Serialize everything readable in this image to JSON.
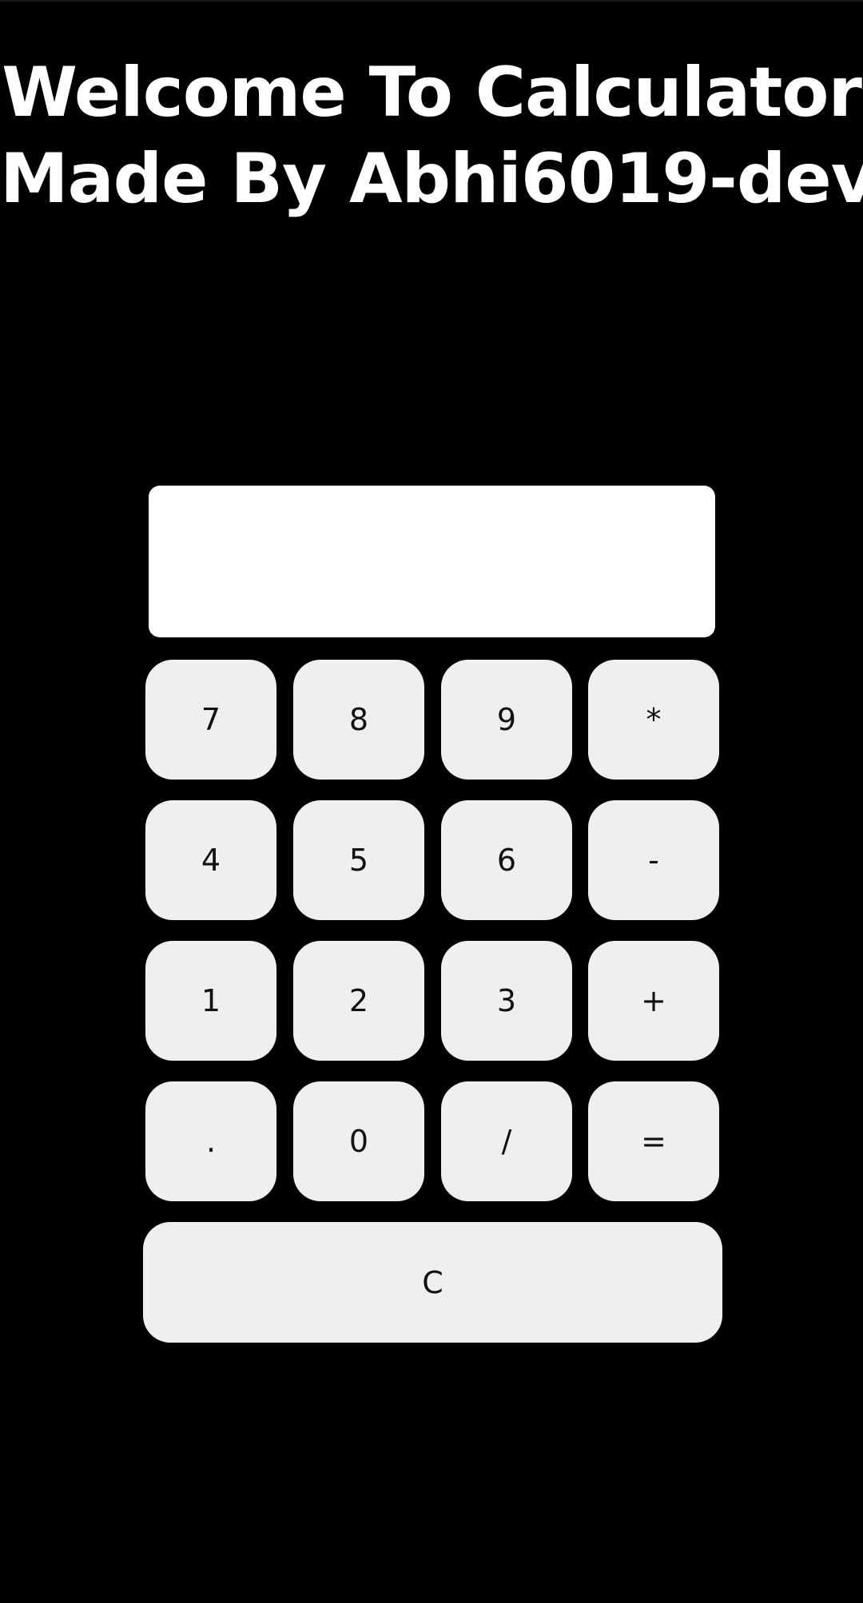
{
  "header": {
    "title_line1": "Welcome To Calculator",
    "title_line2": "Made By Abhi6019-dev"
  },
  "display": {
    "value": ""
  },
  "keypad": {
    "rows": [
      [
        "7",
        "8",
        "9",
        "*"
      ],
      [
        "4",
        "5",
        "6",
        "-"
      ],
      [
        "1",
        "2",
        "3",
        "+"
      ],
      [
        ".",
        "0",
        "/",
        "="
      ]
    ],
    "clear_label": "C"
  },
  "colors": {
    "background": "#000000",
    "title_text": "#ffffff",
    "display_bg": "#ffffff",
    "key_bg": "#efefef",
    "key_text": "#111111"
  }
}
